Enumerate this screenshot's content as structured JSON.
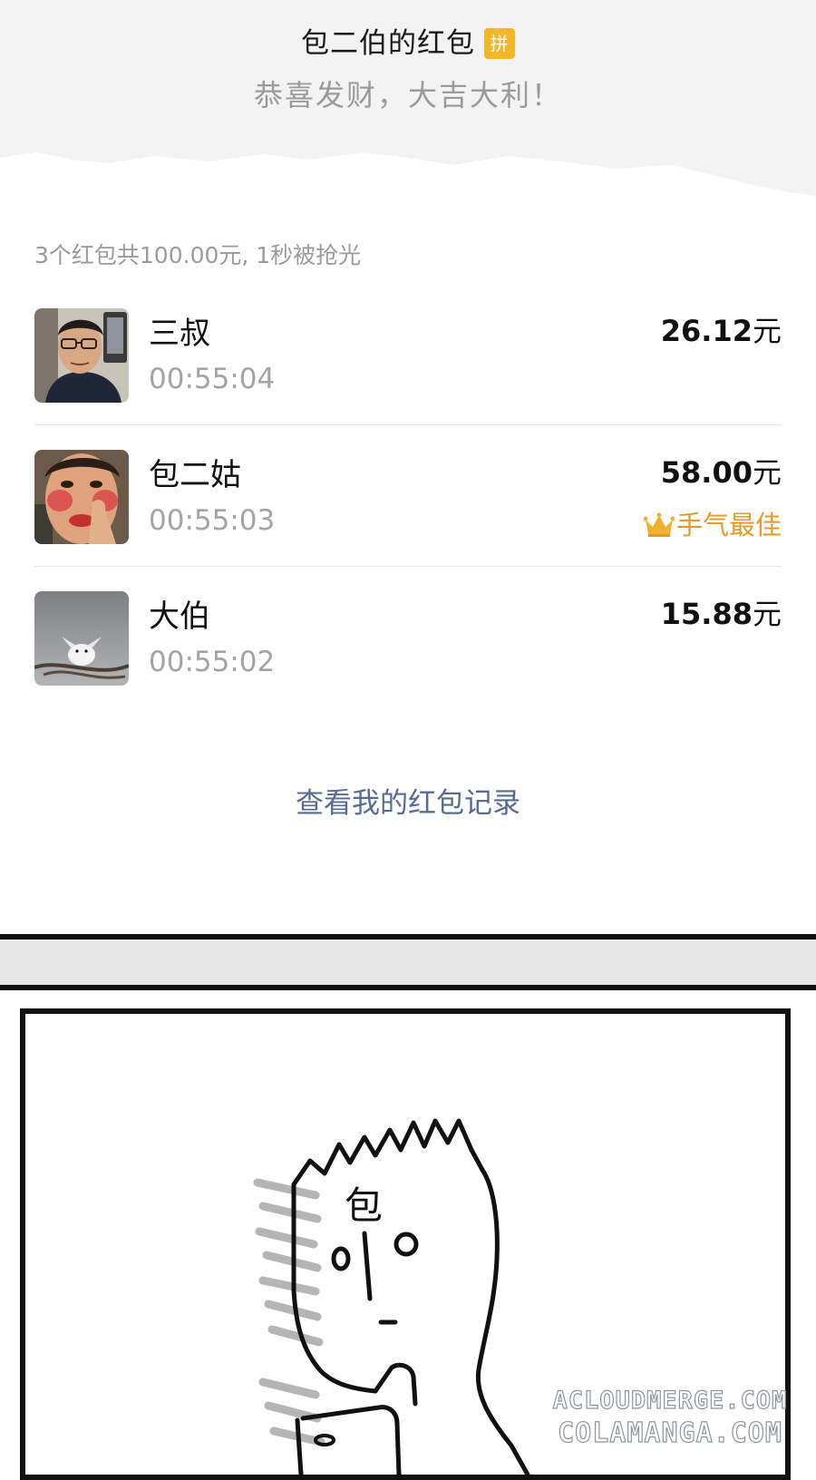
{
  "packet": {
    "title": "包二伯的红包",
    "badge": "拼",
    "greeting": "恭喜发财，大吉大利！",
    "summary": "3个红包共100.00元, 1秒被抢光",
    "entries": [
      {
        "name": "三叔",
        "time": "00:55:04",
        "amount": "26.12",
        "unit": "元",
        "avatar": "man-with-glasses-photo"
      },
      {
        "name": "包二姑",
        "time": "00:55:03",
        "amount": "58.00",
        "unit": "元",
        "avatar": "woman-makeup-photo",
        "best_label": "手气最佳",
        "best_icon": "crown-icon"
      },
      {
        "name": "大伯",
        "time": "00:55:02",
        "amount": "15.88",
        "unit": "元",
        "avatar": "white-bird-photo"
      }
    ],
    "record_link": "查看我的红包记录"
  },
  "comic": {
    "forehead_char": "包"
  },
  "watermarks": [
    "ACLOUDMERGE.COM",
    "COLAMANGA.COM"
  ],
  "colors": {
    "link": "#576b95",
    "best_gold": "#e49b2a",
    "badge_yellow": "#f3b82a"
  }
}
